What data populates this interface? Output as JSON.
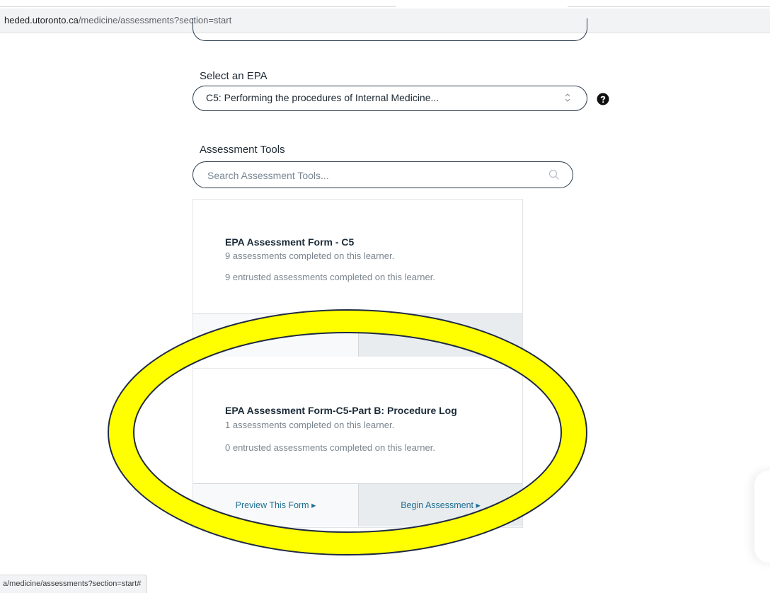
{
  "browser": {
    "url_domain": "heded.utoronto.ca",
    "url_path": "/medicine/assessments?section=start",
    "status_link": "a/medicine/assessments?section=start#"
  },
  "form": {
    "epa_label": "Select an EPA",
    "epa_selected": "C5: Performing the procedures of Internal Medicine...",
    "tools_label": "Assessment Tools",
    "search_placeholder": "Search Assessment Tools..."
  },
  "cards": [
    {
      "title": "EPA Assessment Form - C5",
      "completed": "9 assessments completed on this learner.",
      "entrusted": "9 entrusted assessments completed on this learner."
    },
    {
      "title": "EPA Assessment Form-C5-Part B: Procedure Log",
      "completed": "1 assessments completed on this learner.",
      "entrusted": "0 entrusted assessments completed on this learner.",
      "preview_label": "Preview This Form ▸",
      "begin_label": "Begin Assessment ▸"
    }
  ],
  "colors": {
    "highlight_fill": "#ffff00",
    "highlight_stroke": "#1f2a44",
    "link": "#1f6f93"
  },
  "icons": {
    "select_chevron": "updown-chevron-icon",
    "help": "question-circle-icon",
    "search": "search-icon"
  }
}
